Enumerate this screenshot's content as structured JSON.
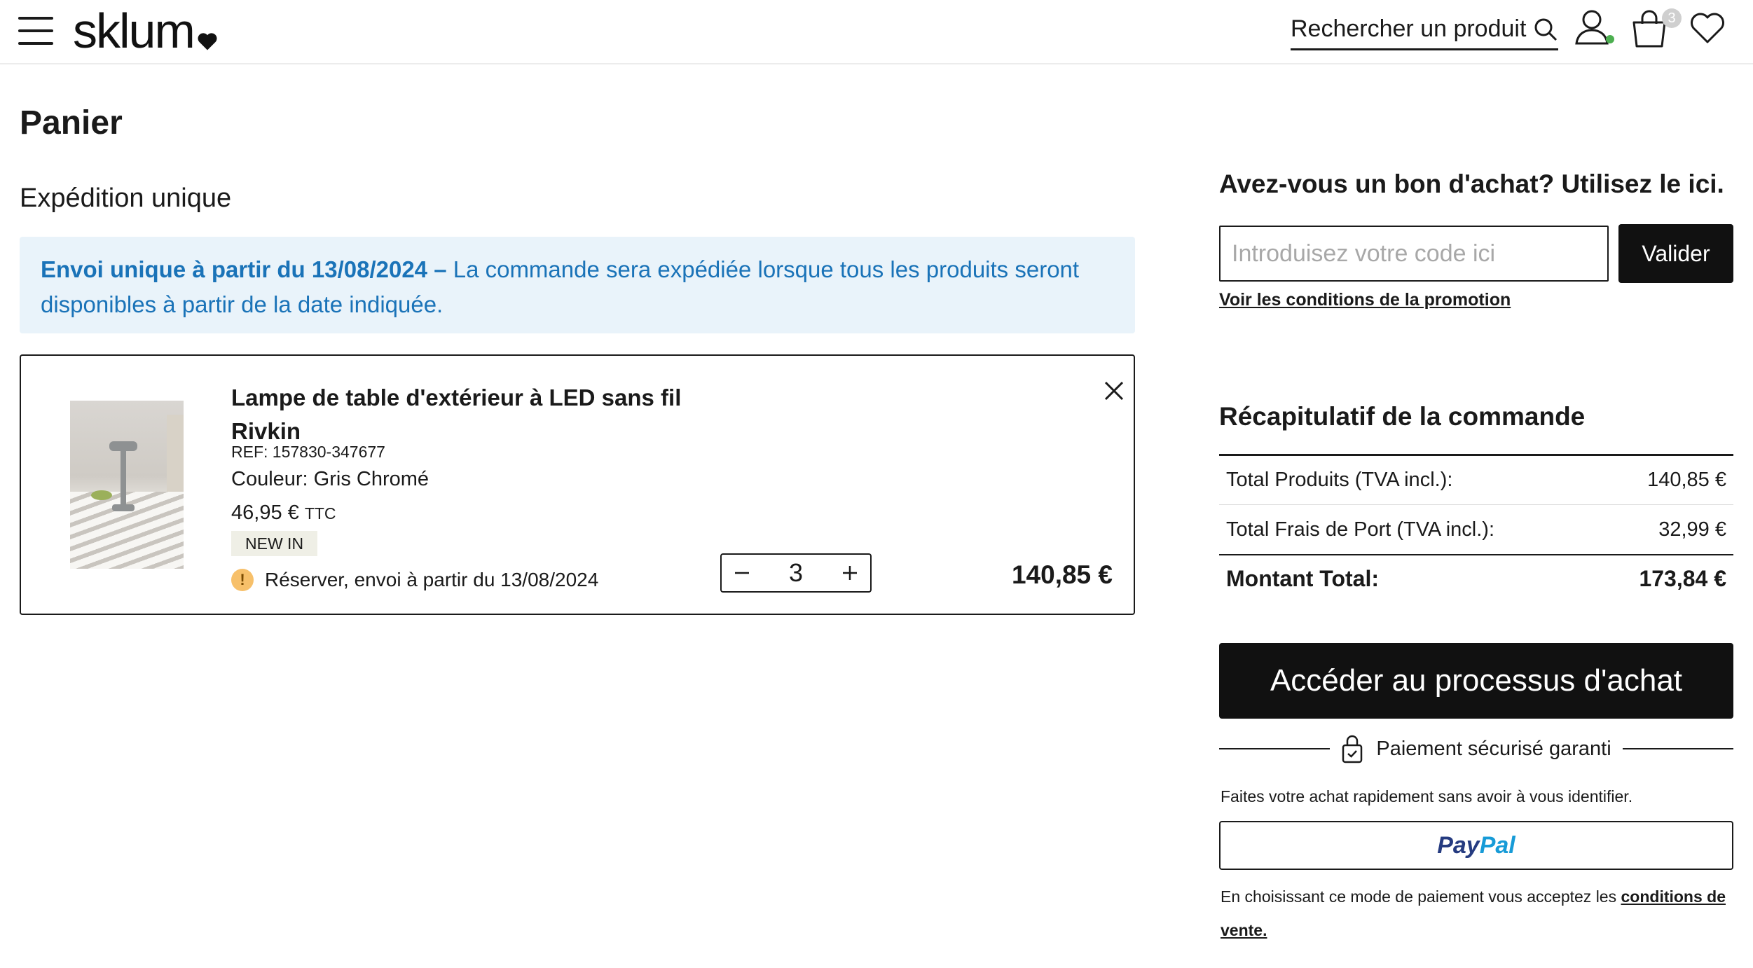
{
  "header": {
    "logo_text": "sklum",
    "search_label": "Rechercher un produit",
    "cart_count": "3"
  },
  "page": {
    "title": "Panier",
    "section_title": "Expédition unique"
  },
  "info_banner": {
    "bold": "Envoi unique à partir du 13/08/2024 –",
    "text": " La commande sera expédiée lorsque tous les produits seront disponibles à partir de la date indiquée."
  },
  "cart_item": {
    "name_line1": "Lampe de table d'extérieur à LED sans fil",
    "name_line2": "Rivkin",
    "ref": "REF: 157830-347677",
    "color": "Couleur: Gris Chromé",
    "price": "46,95 €",
    "price_suffix": "TTC",
    "badge": "NEW IN",
    "reserve_text": "Réserver, envoi à partir du 13/08/2024",
    "quantity": "3",
    "line_total": "140,85 €"
  },
  "voucher": {
    "title": "Avez-vous un bon d'achat? Utilisez le ici.",
    "placeholder": "Introduisez votre code ici",
    "button_label": "Valider",
    "promo_link": "Voir les conditions de la promotion"
  },
  "summary": {
    "title": "Récapitulatif de la commande",
    "rows": [
      {
        "label": "Total Produits (TVA incl.):",
        "value": "140,85 €"
      },
      {
        "label": "Total Frais de Port (TVA incl.):",
        "value": "32,99 €"
      }
    ],
    "total_label": "Montant Total:",
    "total_value": "173,84 €"
  },
  "checkout": {
    "button_label": "Accéder au processus d'achat",
    "secure_text": "Paiement sécurisé garanti",
    "fast_text": "Faites votre achat rapidement sans avoir à vous identifier.",
    "paypal_pay": "Pay",
    "paypal_pal": "Pal",
    "terms_text": "En choisissant ce mode de paiement vous acceptez les ",
    "terms_link": "conditions de vente."
  },
  "colors": {
    "info_bg": "#e9f3fa",
    "info_text": "#1a73b8",
    "button_dark": "#111111",
    "warning": "#f7c06a",
    "online_dot": "#4caf50"
  },
  "icons": [
    "menu-icon",
    "search-icon",
    "user-icon",
    "cart-icon",
    "heart-icon",
    "close-icon",
    "minus-icon",
    "plus-icon",
    "warning-icon",
    "lock-icon"
  ]
}
